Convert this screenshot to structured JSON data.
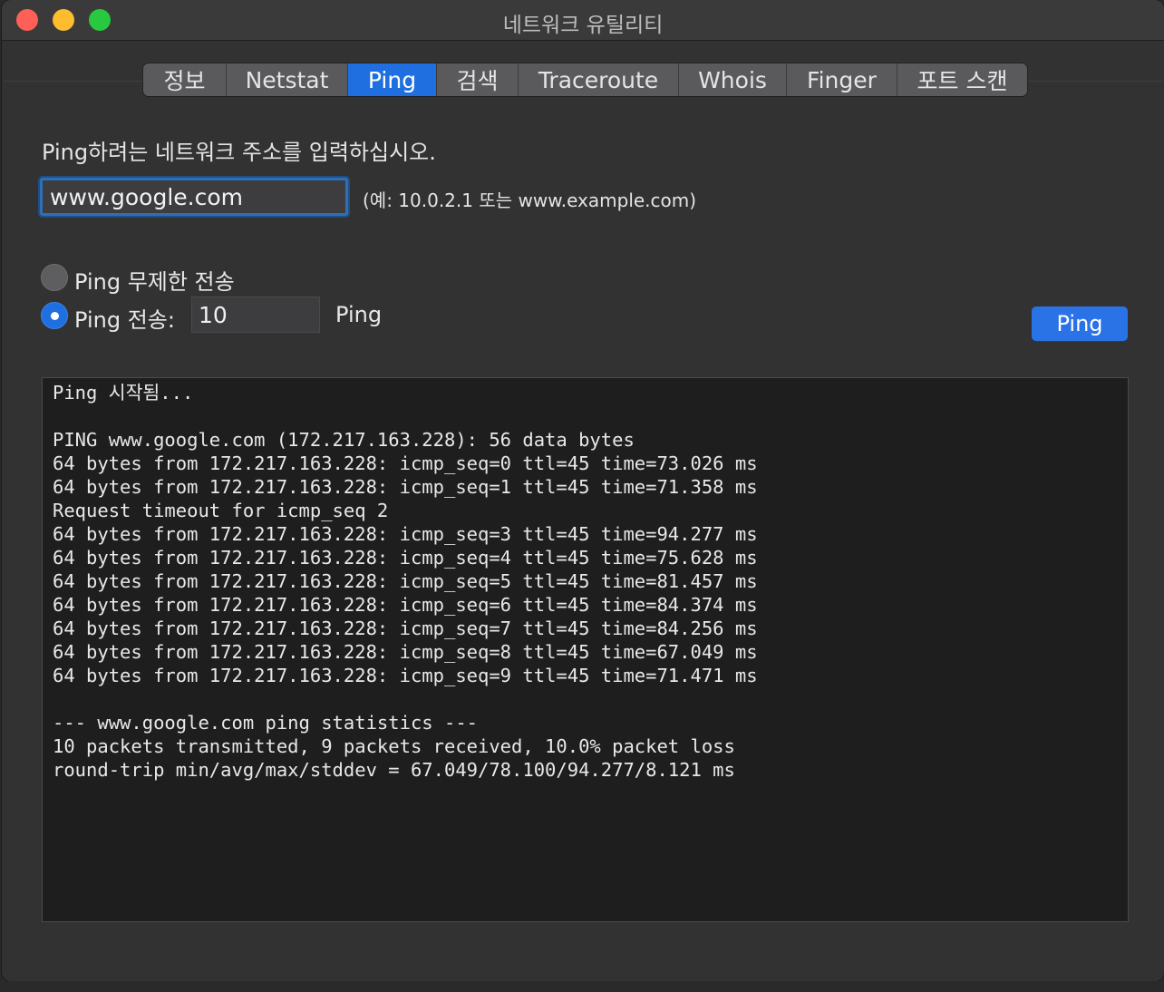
{
  "window": {
    "title": "네트워크 유틸리티"
  },
  "tabs": [
    {
      "label": "정보",
      "active": false
    },
    {
      "label": "Netstat",
      "active": false
    },
    {
      "label": "Ping",
      "active": true
    },
    {
      "label": "검색",
      "active": false
    },
    {
      "label": "Traceroute",
      "active": false
    },
    {
      "label": "Whois",
      "active": false
    },
    {
      "label": "Finger",
      "active": false
    },
    {
      "label": "포트 스캔",
      "active": false
    }
  ],
  "ping": {
    "prompt": "Ping하려는 네트워크 주소를 입력하십시오.",
    "address_value": "www.google.com",
    "hint": "(예: 10.0.2.1 또는 www.example.com)",
    "option_unlimited": "Ping 무제한 전송",
    "option_count": "Ping 전송:",
    "count_value": "10",
    "count_suffix": "Ping",
    "button_label": "Ping",
    "selected_option": "count"
  },
  "output": {
    "lines": [
      "Ping 시작됨...",
      "",
      "PING www.google.com (172.217.163.228): 56 data bytes",
      "64 bytes from 172.217.163.228: icmp_seq=0 ttl=45 time=73.026 ms",
      "64 bytes from 172.217.163.228: icmp_seq=1 ttl=45 time=71.358 ms",
      "Request timeout for icmp_seq 2",
      "64 bytes from 172.217.163.228: icmp_seq=3 ttl=45 time=94.277 ms",
      "64 bytes from 172.217.163.228: icmp_seq=4 ttl=45 time=75.628 ms",
      "64 bytes from 172.217.163.228: icmp_seq=5 ttl=45 time=81.457 ms",
      "64 bytes from 172.217.163.228: icmp_seq=6 ttl=45 time=84.374 ms",
      "64 bytes from 172.217.163.228: icmp_seq=7 ttl=45 time=84.256 ms",
      "64 bytes from 172.217.163.228: icmp_seq=8 ttl=45 time=67.049 ms",
      "64 bytes from 172.217.163.228: icmp_seq=9 ttl=45 time=71.471 ms",
      "",
      "--- www.google.com ping statistics ---",
      "10 packets transmitted, 9 packets received, 10.0% packet loss",
      "round-trip min/avg/max/stddev = 67.049/78.100/94.277/8.121 ms"
    ]
  },
  "colors": {
    "accent": "#1f6fe0",
    "close": "#fe5f57",
    "minimize": "#febc2e",
    "maximize": "#28c840"
  }
}
